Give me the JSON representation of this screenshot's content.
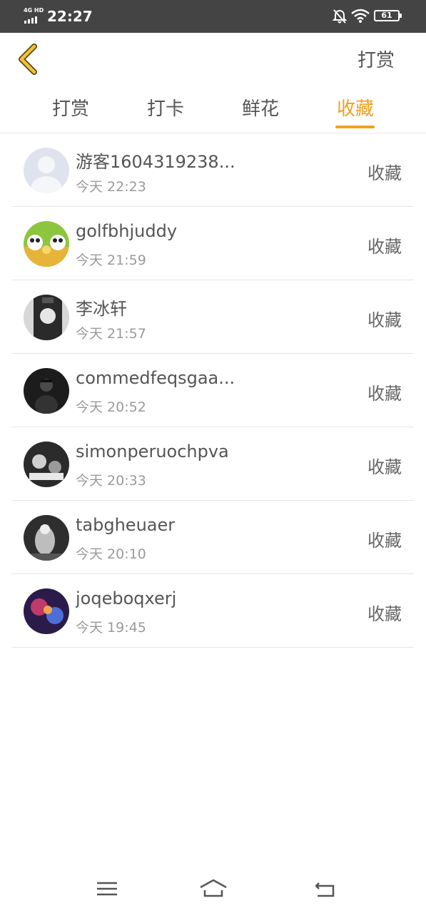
{
  "status_bar": {
    "network": "4G HD",
    "time": "22:27",
    "battery": "61",
    "icons": [
      "signal-icon",
      "mute-bell-icon",
      "wifi-icon",
      "battery-icon"
    ]
  },
  "header": {
    "back_icon": "back-chevron-icon",
    "action_label": "打赏"
  },
  "tabs": [
    {
      "label": "打赏",
      "active": false
    },
    {
      "label": "打卡",
      "active": false
    },
    {
      "label": "鲜花",
      "active": false
    },
    {
      "label": "收藏",
      "active": true
    }
  ],
  "colors": {
    "accent": "#f0a020",
    "status_bar": "#444444",
    "text_primary": "#555555",
    "text_secondary": "#9a9a9a",
    "divider": "#e6e6e6"
  },
  "list": [
    {
      "name": "游客1604319238...",
      "time": "今天 22:23",
      "action": "收藏"
    },
    {
      "name": "golfbhjuddy",
      "time": "今天 21:59",
      "action": "收藏"
    },
    {
      "name": "李冰轩",
      "time": "今天 21:57",
      "action": "收藏"
    },
    {
      "name": "commedfeqsgaa...",
      "time": "今天 20:52",
      "action": "收藏"
    },
    {
      "name": "simonperuochpva",
      "time": "今天 20:33",
      "action": "收藏"
    },
    {
      "name": "tabgheuaer",
      "time": "今天 20:10",
      "action": "收藏"
    },
    {
      "name": "joqeboqxerj",
      "time": "今天 19:45",
      "action": "收藏"
    }
  ],
  "nav_bar": [
    "menu-icon",
    "home-icon",
    "back-icon"
  ]
}
